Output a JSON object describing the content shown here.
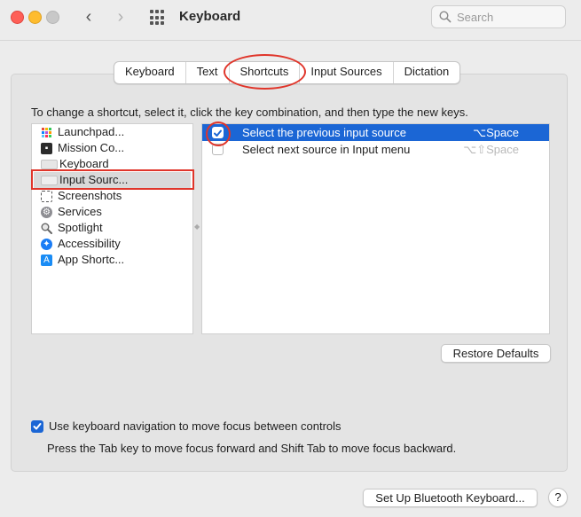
{
  "window": {
    "title": "Keyboard",
    "search_placeholder": "Search"
  },
  "tabs": [
    {
      "label": "Keyboard"
    },
    {
      "label": "Text"
    },
    {
      "label": "Shortcuts",
      "selected": true
    },
    {
      "label": "Input Sources"
    },
    {
      "label": "Dictation"
    }
  ],
  "instructions": "To change a shortcut, select it, click the key combination, and then type the new keys.",
  "categories": [
    {
      "label": "Launchpad...",
      "icon": "launchpad-icon"
    },
    {
      "label": "Mission Co...",
      "icon": "mission-control-icon"
    },
    {
      "label": "Keyboard",
      "icon": "keyboard-icon"
    },
    {
      "label": "Input Sourc...",
      "icon": "input-sources-icon",
      "selected": true
    },
    {
      "label": "Screenshots",
      "icon": "screenshots-icon"
    },
    {
      "label": "Services",
      "icon": "gear-icon"
    },
    {
      "label": "Spotlight",
      "icon": "magnifier-icon"
    },
    {
      "label": "Accessibility",
      "icon": "accessibility-icon"
    },
    {
      "label": "App Shortc...",
      "icon": "app-store-icon"
    }
  ],
  "shortcuts": [
    {
      "label": "Select the previous input source",
      "keys": "⌥Space",
      "checked": true,
      "selected": true
    },
    {
      "label": "Select next source in Input menu",
      "keys": "⌥⇧Space",
      "checked": false,
      "selected": false
    }
  ],
  "buttons": {
    "restore_defaults": "Restore Defaults",
    "bluetooth": "Set Up Bluetooth Keyboard...",
    "help": "?"
  },
  "keyboard_navigation": {
    "label": "Use keyboard navigation to move focus between controls",
    "checked": true,
    "hint": "Press the Tab key to move focus forward and Shift Tab to move focus backward."
  },
  "colors": {
    "accent": "#1b66d5",
    "annotation": "#e0352a"
  }
}
